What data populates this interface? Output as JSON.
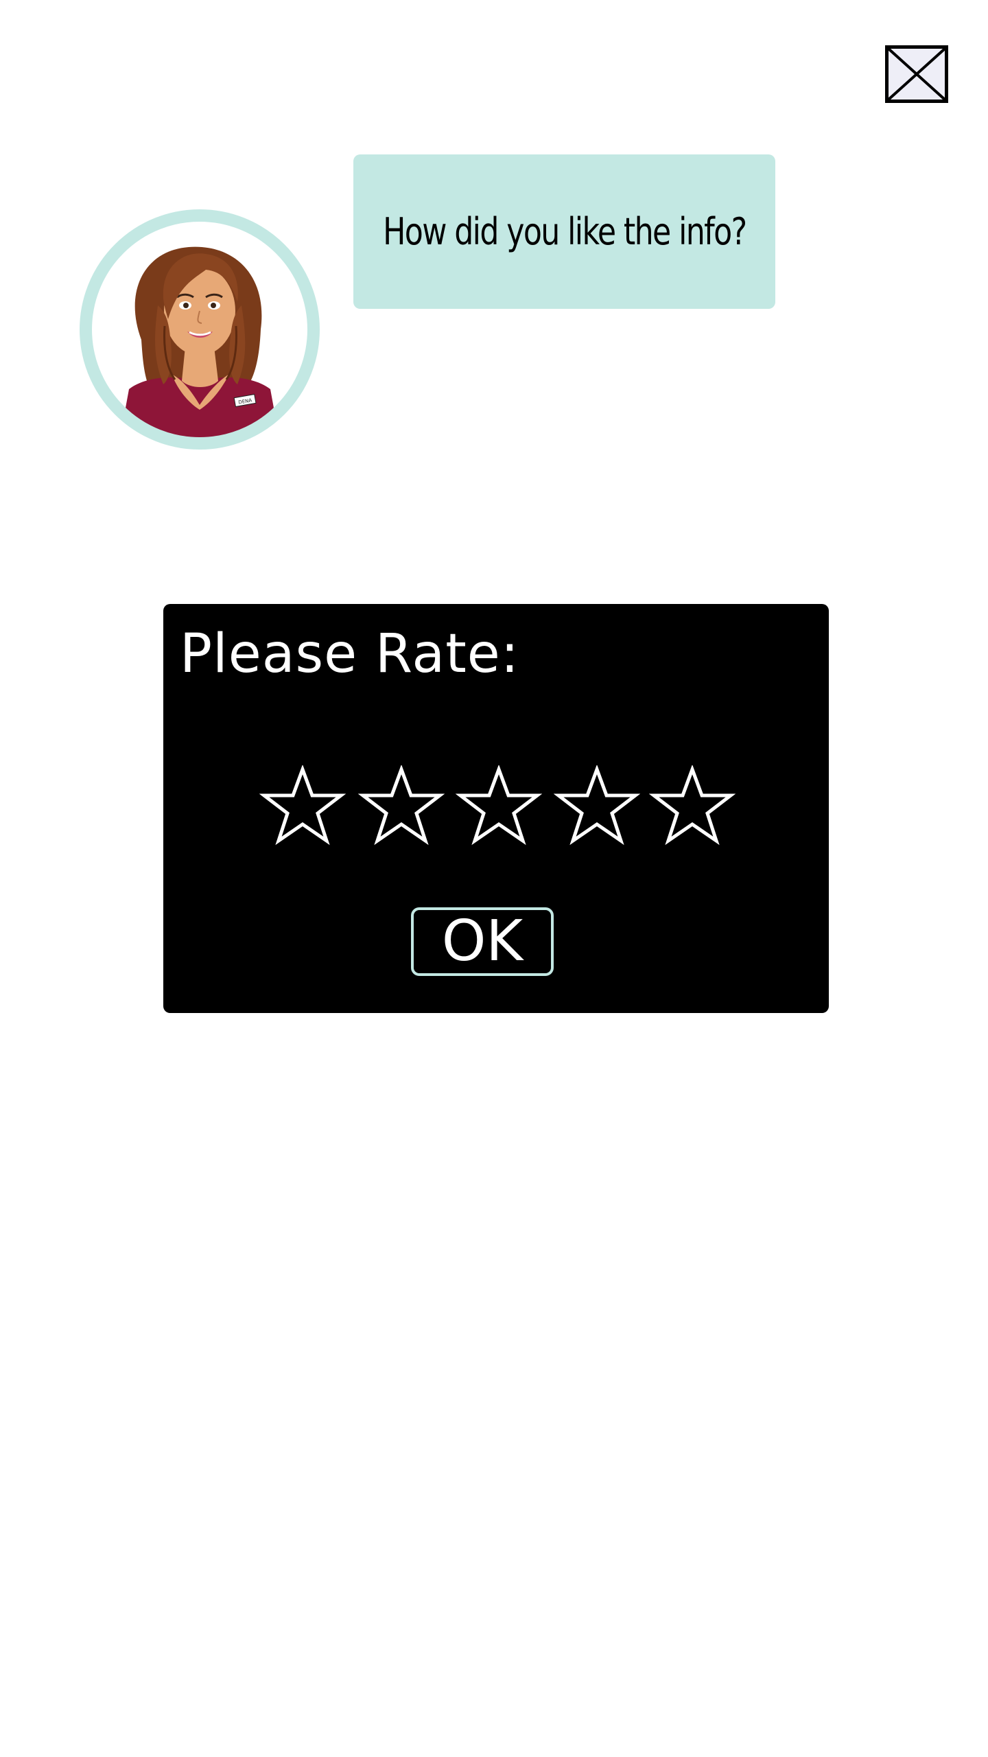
{
  "close_button": {
    "icon": "close-icon",
    "background": "#eeeef7",
    "border": "#000000"
  },
  "speech_bubble": {
    "text": "How did you like the info?",
    "background": "#c3e8e3"
  },
  "avatar": {
    "ring_color": "#c3e8e3",
    "badge_text": "DENA",
    "shirt_color": "#8e1538",
    "hair_color": "#7a3b1a"
  },
  "rating_panel": {
    "background": "#000000",
    "title": "Please Rate:",
    "stars": [
      {
        "icon": "star-outline-icon"
      },
      {
        "icon": "star-outline-icon"
      },
      {
        "icon": "star-outline-icon"
      },
      {
        "icon": "star-outline-icon"
      },
      {
        "icon": "star-outline-icon"
      }
    ],
    "rating_value": 0,
    "rating_max": 5,
    "ok_label": "OK",
    "ok_border_color": "#c3e8e3"
  }
}
